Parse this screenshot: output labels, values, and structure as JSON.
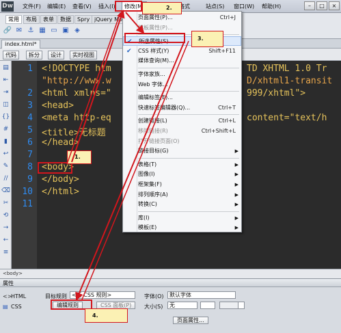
{
  "titlebar": {
    "logo": "Dw",
    "menus": [
      "文件(F)",
      "编辑(E)",
      "查看(V)",
      "插入(I)",
      "修改(M)",
      "格式",
      "站点(S)",
      "窗口(W)",
      "帮助(H)"
    ],
    "window_controls": [
      "minimize-icon",
      "maximize-icon",
      "close-icon"
    ]
  },
  "insert_bar": {
    "tabs": [
      "常用",
      "布局",
      "表单",
      "数据",
      "Spry",
      "jQuery Mob"
    ],
    "icon_names": [
      "link-icon",
      "email-icon",
      "anchor-icon",
      "table-icon",
      "div-icon",
      "image-icon",
      "media-icon"
    ]
  },
  "document_tab": "index.html*",
  "view_bar": {
    "buttons": [
      "代码",
      "拆分",
      "设计",
      "实时视图"
    ]
  },
  "left_tools": [
    "open-docs-icon",
    "collapse-icon",
    "expand-icon",
    "select-parent-icon",
    "balance-braces-icon",
    "line-numbers-icon",
    "highlight-icon",
    "wrap-icon",
    "syntax-icon",
    "comment-icon",
    "uncomment-icon",
    "snippet-icon",
    "recent-icon",
    "indent-icon",
    "outdent-icon",
    "format-icon"
  ],
  "code": {
    "line_numbers": [
      "1",
      "",
      "2",
      "3",
      "4",
      "5",
      "6",
      "7",
      "8",
      "9",
      "10",
      "11"
    ],
    "lines": [
      "<!DOCTYPE htm",
      "\"http://www.w",
      "<html xmlns=\"",
      "<head>",
      "<meta http-eq",
      "<title>无标题",
      "</head>",
      "",
      "<body>",
      "</body>",
      "</html>"
    ],
    "right_fragments": [
      "TD XHTML 1.0 Tr",
      "D/xhtml1-transit",
      "999/xhtml\">",
      "content=\"text/h"
    ]
  },
  "status_bar": {
    "tag": "<body>"
  },
  "properties": {
    "title": "属性",
    "html_label": "HTML",
    "css_label": "CSS",
    "target_rule_label": "目标规则",
    "target_rule_value": "<新 CSS 规则>",
    "edit_rule_button": "编辑规则",
    "css_panel_button": "CSS 面板(P)",
    "font_label": "字体(O)",
    "font_value": "默认字体",
    "size_label": "大小(S)",
    "size_value": "无",
    "page_props_button": "页面属性..."
  },
  "menu": {
    "items": [
      {
        "label": "页面属性(P)...",
        "shortcut": "Ctrl+J"
      },
      {
        "label": "模板属性(P)...",
        "disabled": true
      },
      {
        "sep": true
      },
      {
        "label": "所选属性(S)",
        "checked": true,
        "highlight": true
      },
      {
        "label": "CSS 样式(Y)",
        "shortcut": "Shift+F11",
        "checked": true
      },
      {
        "label": "媒体查询(M)..."
      },
      {
        "sep": true
      },
      {
        "label": "字体家族..."
      },
      {
        "label": "Web 字体..."
      },
      {
        "sep": true
      },
      {
        "label": "编辑标签(E)..."
      },
      {
        "label": "快速标签编辑器(Q)...",
        "shortcut": "Ctrl+T"
      },
      {
        "sep": true
      },
      {
        "label": "创建链接(L)",
        "shortcut": "Ctrl+L"
      },
      {
        "label": "移除链接(R)",
        "shortcut": "Ctrl+Shift+L",
        "disabled": true
      },
      {
        "label": "打开链接页面(O)",
        "disabled": true
      },
      {
        "label": "链接目标(G)",
        "submenu": true
      },
      {
        "sep": true
      },
      {
        "label": "表格(T)",
        "submenu": true
      },
      {
        "label": "图像(I)",
        "submenu": true
      },
      {
        "label": "框架集(F)",
        "submenu": true
      },
      {
        "label": "排列顺序(A)",
        "submenu": true
      },
      {
        "label": "转换(C)",
        "submenu": true
      },
      {
        "sep": true
      },
      {
        "label": "库(I)",
        "submenu": true
      },
      {
        "label": "模板(E)",
        "submenu": true
      }
    ]
  },
  "callouts": [
    "1.",
    "2.",
    "3.",
    "4."
  ],
  "colors": {
    "code_tag": "#e6c35b",
    "line_number": "#2f8cf2",
    "annotation": "#d2161d",
    "callout_fill": "#fbf1b4",
    "menu_highlight": "#dce9fb"
  }
}
